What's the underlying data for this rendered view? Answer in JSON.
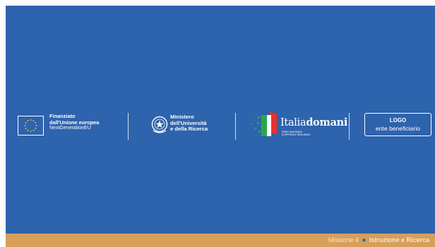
{
  "eu": {
    "line1": "Finanziato",
    "line2": "dall'Unione europea",
    "line3": "NextGenerationEU"
  },
  "ministry": {
    "line1": "Ministero",
    "line2": "dell'Università",
    "line3": "e della Ricerca"
  },
  "italia_domani": {
    "title_regular": "Italia",
    "title_bold": "domani",
    "sub1": "PIANO NAZIONALE",
    "sub2": "DI RIPRESA E RESILIENZA"
  },
  "beneficiary": {
    "logo": "LOGO",
    "label": "ente beneficiario"
  },
  "footer": {
    "mission": "Missione 4",
    "topic": "Istruzione e Ricerca"
  },
  "colors": {
    "background": "#2e63ad",
    "footer_band": "#d79f59"
  }
}
